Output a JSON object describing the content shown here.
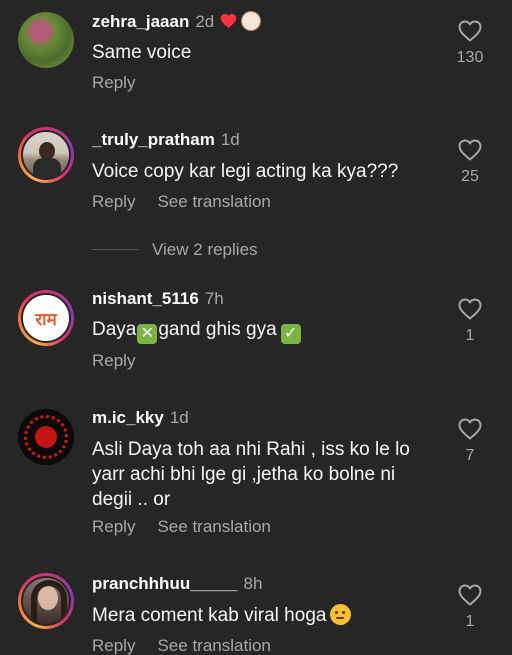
{
  "comments": [
    {
      "username": "zehra_jaaan",
      "time": "2d",
      "text": "Same voice",
      "reply_label": "Reply",
      "translate_label": "",
      "likes": "130",
      "creator_liked": true
    },
    {
      "username": "_truly_pratham",
      "time": "1d",
      "text": "Voice copy kar legi acting ka kya???",
      "reply_label": "Reply",
      "translate_label": "See translation",
      "likes": "25"
    },
    {
      "username": "nishant_5116",
      "time": "7h",
      "text_before": "Daya",
      "text_middle": "gand ghis gya",
      "reply_label": "Reply",
      "translate_label": "",
      "likes": "1",
      "avatar_text": "राम"
    },
    {
      "username": "m.ic_kky",
      "time": "1d",
      "text": "Asli Daya toh aa nhi Rahi , iss ko le lo yarr achi bhi lge gi ,jetha ko bolne ni degii .. or",
      "reply_label": "Reply",
      "translate_label": "See translation",
      "likes": "7"
    },
    {
      "username": "pranchhhuu_____",
      "time": "8h",
      "text": "Mera coment kab viral hoga",
      "reply_label": "Reply",
      "translate_label": "See translation",
      "likes": "1"
    }
  ],
  "view_replies": "View 2 replies",
  "icons": {
    "like": "heart-outline-icon",
    "creator_like": "heart-filled-icon"
  },
  "colors": {
    "background": "#262626",
    "secondary_text": "#a8a8a8",
    "heart_red": "#ff3040"
  }
}
